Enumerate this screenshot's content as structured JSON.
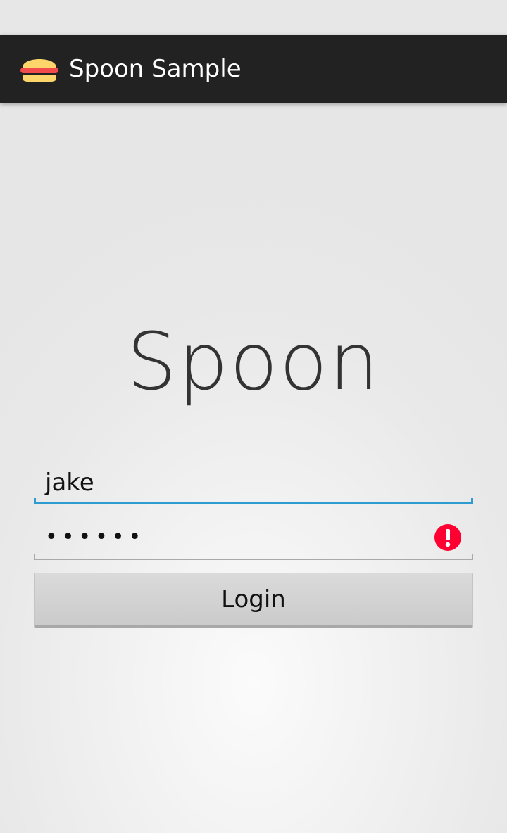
{
  "app_bar": {
    "title": "Spoon Sample",
    "icon": "burger-icon"
  },
  "main": {
    "hero_title": "Spoon",
    "username": {
      "value": "jake"
    },
    "password": {
      "value": "••••••",
      "error_icon": "error-alert-icon"
    },
    "login_label": "Login"
  },
  "colors": {
    "action_bar": "#222222",
    "focus_accent": "#2e9bd1",
    "error": "#ff0033"
  }
}
